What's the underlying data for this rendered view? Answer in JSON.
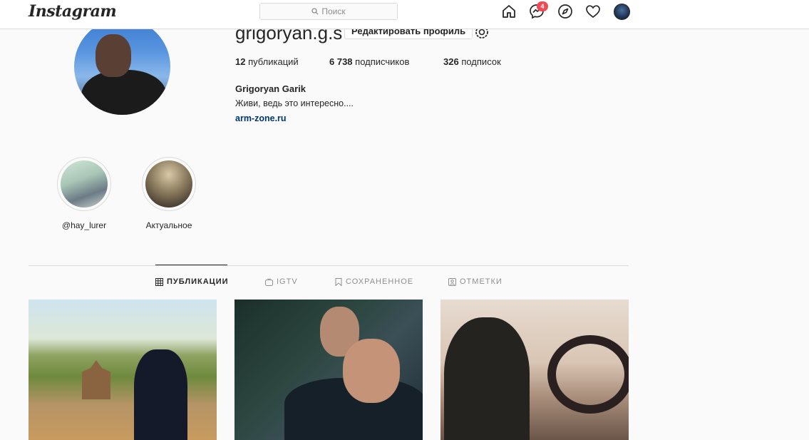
{
  "topbar": {
    "logo": "Instagram",
    "search_placeholder": "Поиск",
    "messages_badge": "4",
    "icons": [
      "home-icon",
      "messenger-icon",
      "explore-icon",
      "heart-icon",
      "avatar"
    ]
  },
  "profile": {
    "username": "grigoryan.g.s",
    "edit_button": "Редактировать профиль",
    "stats": {
      "posts_value": "12",
      "posts_label": "публикаций",
      "followers_value": "6 738",
      "followers_label": "подписчиков",
      "following_value": "326",
      "following_label": "подписок"
    },
    "full_name": "Grigoryan Garik",
    "bio": "Живи, ведь это интересно....",
    "link": "arm-zone.ru"
  },
  "highlights": [
    {
      "label": "@hay_lurer"
    },
    {
      "label": "Актуальное"
    }
  ],
  "tabs": [
    {
      "label": "ПУБЛИКАЦИИ",
      "active": true
    },
    {
      "label": "IGTV",
      "active": false
    },
    {
      "label": "СОХРАНЕННОЕ",
      "active": false
    },
    {
      "label": "ОТМЕТКИ",
      "active": false
    }
  ],
  "colors": {
    "badge": "#ed4956",
    "link": "#00376b",
    "border": "#dbdbdb",
    "muted": "#8e8e8e"
  }
}
